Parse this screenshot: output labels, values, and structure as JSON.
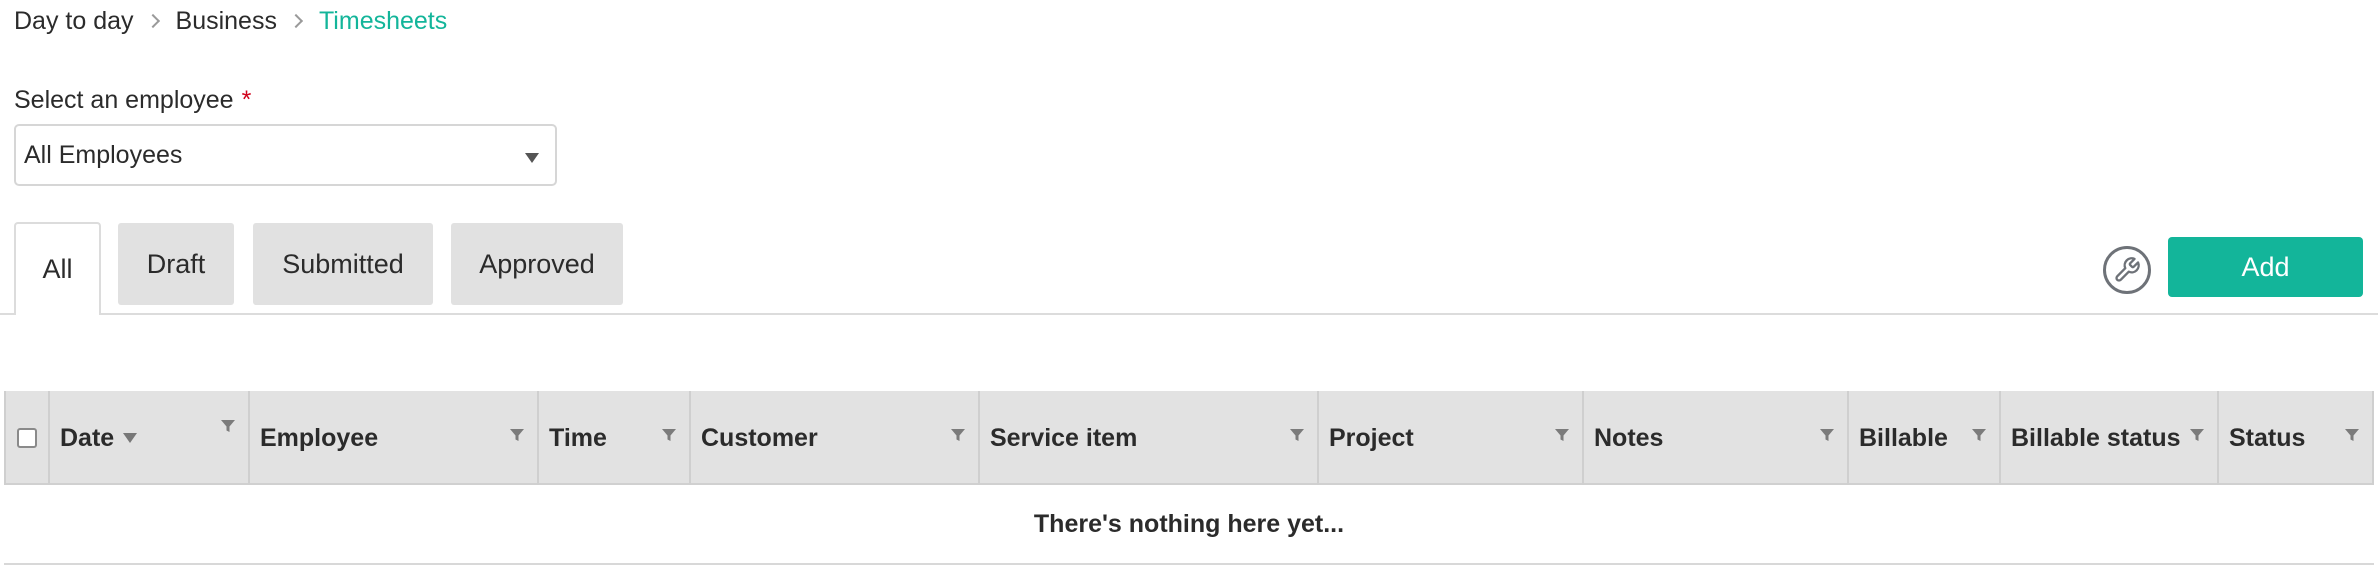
{
  "breadcrumb": {
    "items": [
      "Day to day",
      "Business",
      "Timesheets"
    ]
  },
  "employee_select": {
    "label": "Select an employee",
    "required_marker": "*",
    "value": "All Employees"
  },
  "tabs": [
    {
      "label": "All",
      "active": true
    },
    {
      "label": "Draft",
      "active": false
    },
    {
      "label": "Submitted",
      "active": false
    },
    {
      "label": "Approved",
      "active": false
    }
  ],
  "toolbar": {
    "settings_icon": "wrench-icon",
    "add_label": "Add"
  },
  "grid": {
    "columns": [
      {
        "label": "Date",
        "sorted": "desc"
      },
      {
        "label": "Employee"
      },
      {
        "label": "Time"
      },
      {
        "label": "Customer"
      },
      {
        "label": "Service item"
      },
      {
        "label": "Project"
      },
      {
        "label": "Notes"
      },
      {
        "label": "Billable"
      },
      {
        "label": "Billable status"
      },
      {
        "label": "Status"
      }
    ],
    "empty_message": "There's nothing here yet..."
  },
  "colors": {
    "accent": "#13b59a",
    "required": "#d0021b",
    "header_bg": "#e2e2e2",
    "tab_inactive_bg": "#e1e1e1"
  }
}
